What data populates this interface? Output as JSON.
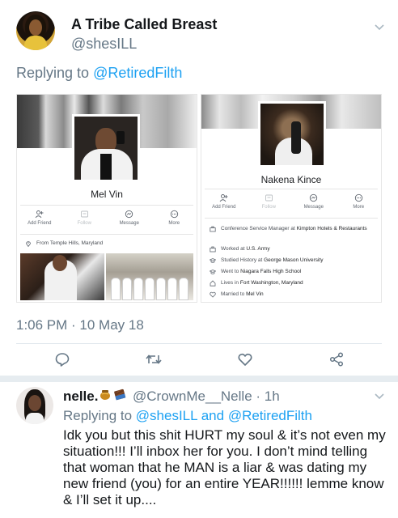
{
  "tweet": {
    "display_name": "A Tribe Called Breast",
    "handle": "@shesILL",
    "replying_prefix": "Replying to",
    "replying_to": "@RetiredFilth",
    "timestamp": "1:06 PM · 10 May 18",
    "avatar_icon": "user-avatar",
    "menu_icon": "chevron-down-icon"
  },
  "attached_image": {
    "left_profile": {
      "name": "Mel Vin",
      "actions": [
        "Add Friend",
        "Follow",
        "Message",
        "More"
      ],
      "from": "From Temple Hills, Maryland"
    },
    "right_profile": {
      "name": "Nakena Kince",
      "actions": [
        "Add Friend",
        "Follow",
        "Message",
        "More"
      ],
      "info": [
        {
          "prefix": "Conference Service Manager at ",
          "bold": "Kimpton Hotels & Restaurants"
        },
        {
          "prefix": "Worked at ",
          "bold": "U.S. Army"
        },
        {
          "prefix": "Studied History at ",
          "bold": "George Mason University"
        },
        {
          "prefix": "Went to ",
          "bold": "Niagara Falls High School"
        },
        {
          "prefix": "Lives in ",
          "bold": "Fort Washington, Maryland"
        },
        {
          "prefix": "Married to ",
          "bold": "Mel Vin"
        }
      ]
    }
  },
  "actions": [
    "reply-icon",
    "retweet-icon",
    "like-icon",
    "share-icon"
  ],
  "reply": {
    "display_name": "nelle.",
    "emojis": [
      "honey-pot-emoji",
      "chocolate-bar-emoji"
    ],
    "handle_time": "@CrownMe__Nelle · 1h",
    "replying_prefix": "Replying to",
    "replying_to_1": "@shesILL",
    "replying_joiner": "and",
    "replying_to_2": "@RetiredFilth",
    "text": "Idk you but this shit HURT my soul & it’s not even my situation!!! I’ll inbox her for you. I don’t mind telling that woman that he MAN is a liar & was dating my new friend (you) for an entire YEAR!!!!!! lemme know & I’ll set it up...."
  },
  "colors": {
    "link": "#1da1f2",
    "secondary": "#657786",
    "text": "#14171a",
    "separator": "#e6ecf0"
  }
}
